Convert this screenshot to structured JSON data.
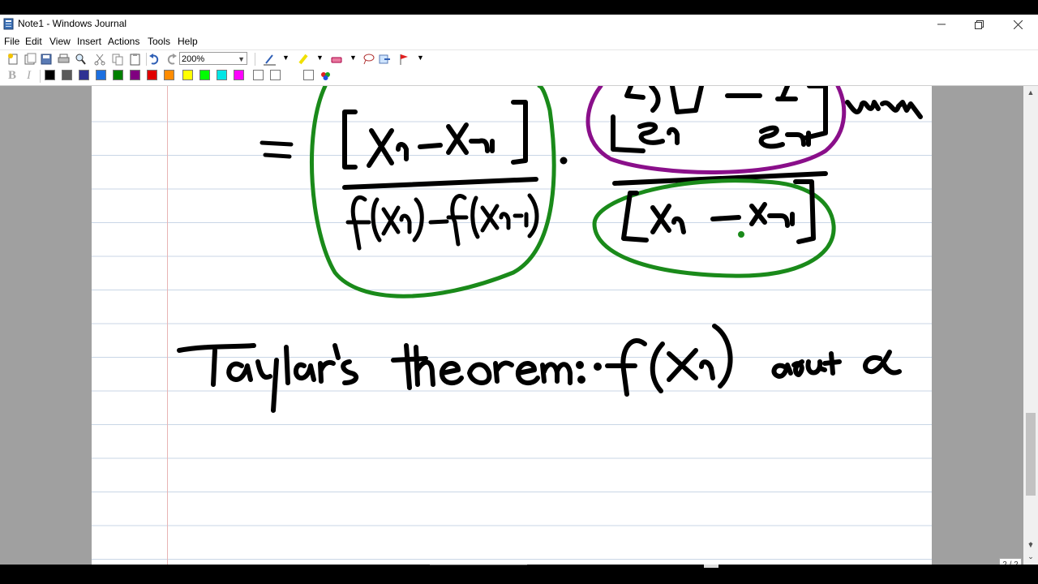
{
  "window": {
    "title": "Note1 - Windows Journal"
  },
  "menu": [
    "File",
    "Edit",
    "View",
    "Insert",
    "Actions",
    "Tools",
    "Help"
  ],
  "toolbar": {
    "zoom": "200%"
  },
  "format": {
    "bold": "B",
    "italic": "I"
  },
  "palette": [
    "#000000",
    "#5a5a5a",
    "#2e3192",
    "#1c6fe0",
    "#008000",
    "#800080",
    "#e00000",
    "#ff8c00",
    "#ffff00",
    "#00ff00",
    "#00e5e5",
    "#ff00ff",
    "#ffffff",
    "#ffffff",
    "#ffffff"
  ],
  "ink_colors": {
    "black": "#000000",
    "green": "#1a8a1a",
    "purple": "#8a0f8a"
  },
  "page_indicator": "2 / 2"
}
